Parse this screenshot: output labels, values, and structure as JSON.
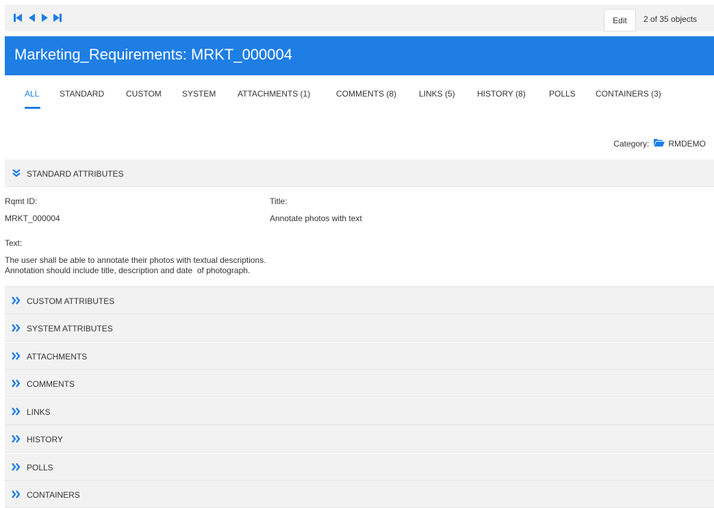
{
  "toolbar": {
    "nav_icons": [
      "first-page-icon",
      "previous-icon",
      "next-icon",
      "last-page-icon"
    ],
    "edit_label": "Edit",
    "object_count": "2 of 35 objects"
  },
  "banner": {
    "title": "Marketing_Requirements: MRKT_000004",
    "color": "#1e7ee4"
  },
  "tabs": [
    {
      "label": "ALL",
      "active": true
    },
    {
      "label": "STANDARD"
    },
    {
      "label": "CUSTOM"
    },
    {
      "label": "SYSTEM"
    },
    {
      "label": "ATTACHMENTS (1)"
    },
    {
      "label": "COMMENTS (8)"
    },
    {
      "label": "LINKS (5)"
    },
    {
      "label": "HISTORY (8)"
    },
    {
      "label": "POLLS"
    },
    {
      "label": "CONTAINERS (3)"
    }
  ],
  "category": {
    "label": "Category:",
    "icon": "folder-icon",
    "value": "RMDEMO"
  },
  "standard": {
    "header": "STANDARD ATTRIBUTES",
    "expanded": true,
    "rqmt_id_label": "Rqmt ID:",
    "rqmt_id_value": "MRKT_000004",
    "title_label": "Title:",
    "title_value": "Annotate photos with text",
    "text_label": "Text:",
    "text_lines": [
      "The user shall be able to annotate their photos with textual descriptions.",
      "Annotation should include title, description and date  of photograph."
    ]
  },
  "sections": [
    {
      "label": "CUSTOM ATTRIBUTES"
    },
    {
      "label": "SYSTEM ATTRIBUTES"
    },
    {
      "label": "ATTACHMENTS"
    },
    {
      "label": "COMMENTS"
    },
    {
      "label": "LINKS"
    },
    {
      "label": "HISTORY"
    },
    {
      "label": "POLLS"
    },
    {
      "label": "CONTAINERS"
    }
  ]
}
